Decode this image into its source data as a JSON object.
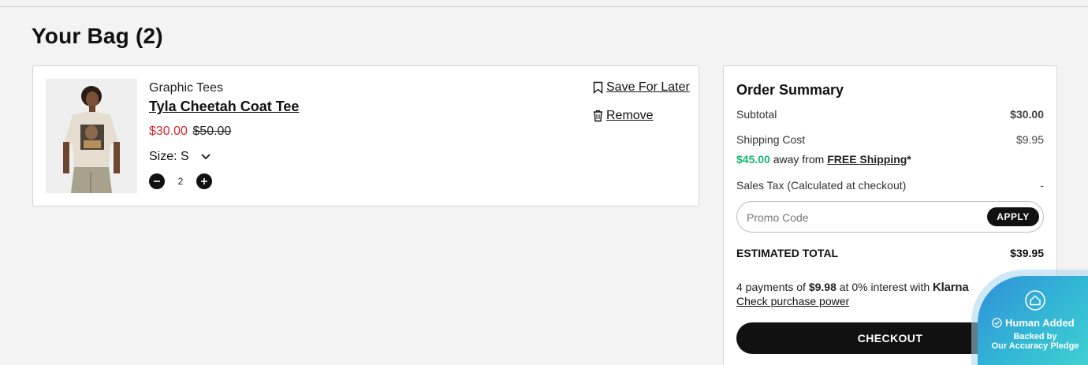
{
  "page": {
    "title": "Your Bag (2)"
  },
  "cart": {
    "item": {
      "category": "Graphic Tees",
      "name": "Tyla Cheetah Coat Tee",
      "sale_price": "$30.00",
      "original_price": "$50.00",
      "size_label": "Size: S",
      "quantity": "2",
      "save_for_later": "Save For Later",
      "remove": "Remove"
    }
  },
  "summary": {
    "title": "Order Summary",
    "subtotal_label": "Subtotal",
    "subtotal_value": "$30.00",
    "shipping_label": "Shipping Cost",
    "shipping_value": "$9.95",
    "free_ship_amount": "$45.00",
    "free_ship_text": " away from ",
    "free_ship_link": "FREE Shipping",
    "free_ship_asterisk": "*",
    "tax_label": "Sales Tax (Calculated at checkout)",
    "tax_value": "-",
    "promo_placeholder": "Promo Code",
    "apply_label": "APPLY",
    "total_label": "ESTIMATED TOTAL",
    "total_value": "$39.95",
    "klarna_prefix": "4 payments of ",
    "klarna_amount": "$9.98",
    "klarna_mid": " at 0% interest with ",
    "klarna_brand": "Klarna",
    "klarna_link": "Check purchase power",
    "checkout_label": "CHECKOUT"
  },
  "badge": {
    "title": "Human Added",
    "line1": "Backed by",
    "line2": "Our Accuracy Pledge"
  },
  "colors": {
    "sale": "#d6262f",
    "free_shipping": "#14b86e",
    "button": "#111111",
    "badge": "#33b7d6"
  }
}
